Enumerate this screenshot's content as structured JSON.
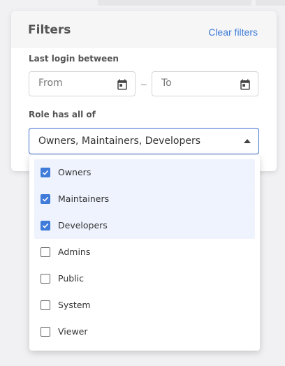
{
  "filters": {
    "title": "Filters",
    "clear_label": "Clear filters",
    "last_login": {
      "label": "Last login between",
      "from_placeholder": "From",
      "to_placeholder": "To",
      "separator": "–"
    },
    "role": {
      "label": "Role has all of",
      "selected_text": "Owners, Maintainers, Developers",
      "options": [
        {
          "label": "Owners",
          "checked": true
        },
        {
          "label": "Maintainers",
          "checked": true
        },
        {
          "label": "Developers",
          "checked": true
        },
        {
          "label": "Admins",
          "checked": false
        },
        {
          "label": "Public",
          "checked": false
        },
        {
          "label": "System",
          "checked": false
        },
        {
          "label": "Viewer",
          "checked": false
        }
      ]
    }
  },
  "colors": {
    "accent": "#3f7bd9",
    "selected_row": "#eef3fd"
  }
}
